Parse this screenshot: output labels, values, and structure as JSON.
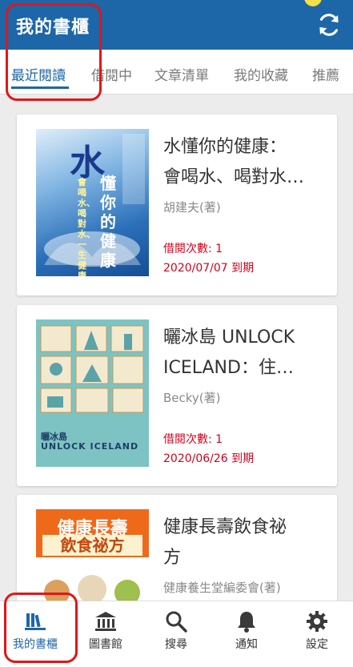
{
  "header": {
    "title": "我的書櫃",
    "refresh_icon": "refresh-icon"
  },
  "tabs": [
    {
      "label": "最近閱讀",
      "active": true
    },
    {
      "label": "借閱中",
      "active": false
    },
    {
      "label": "文章清單",
      "active": false
    },
    {
      "label": "我的收藏",
      "active": false
    },
    {
      "label": "推薦",
      "active": false
    }
  ],
  "books": [
    {
      "title_line1": "水懂你的健康：",
      "title_line2": "會喝水、喝對水…",
      "author": "胡建夫(著)",
      "borrow_count": "借閱次數: 1",
      "due": "2020/07/07 到期",
      "cover": {
        "big_char": "水",
        "sub_text": "懂你的健康",
        "tagline": "會喝水、喝對水、一生健康"
      }
    },
    {
      "title_line1": "曬冰島 UNLOCK",
      "title_line2": "ICELAND：住…",
      "author": "Becky(著)",
      "borrow_count": "借閱次數: 1",
      "due": "2020/06/26 到期",
      "cover": {
        "title_zh": "曬冰島",
        "title_en": "UNLOCK ICELAND"
      }
    },
    {
      "title_line1": "健康長壽飲食祕",
      "title_line2": "方",
      "author": "健康養生堂編委會(著)",
      "cover": {
        "line1": "健康長壽",
        "line2": "飲食祕方"
      }
    }
  ],
  "bottom_nav": [
    {
      "label": "我的書櫃",
      "icon": "bookshelf-icon",
      "active": true
    },
    {
      "label": "圖書館",
      "icon": "library-icon",
      "active": false
    },
    {
      "label": "搜尋",
      "icon": "search-icon",
      "active": false
    },
    {
      "label": "通知",
      "icon": "bell-icon",
      "active": false
    },
    {
      "label": "設定",
      "icon": "gear-icon",
      "active": false
    }
  ],
  "colors": {
    "primary": "#1d66a7",
    "accent_red": "#d0021b",
    "highlight": "#e3151a"
  }
}
